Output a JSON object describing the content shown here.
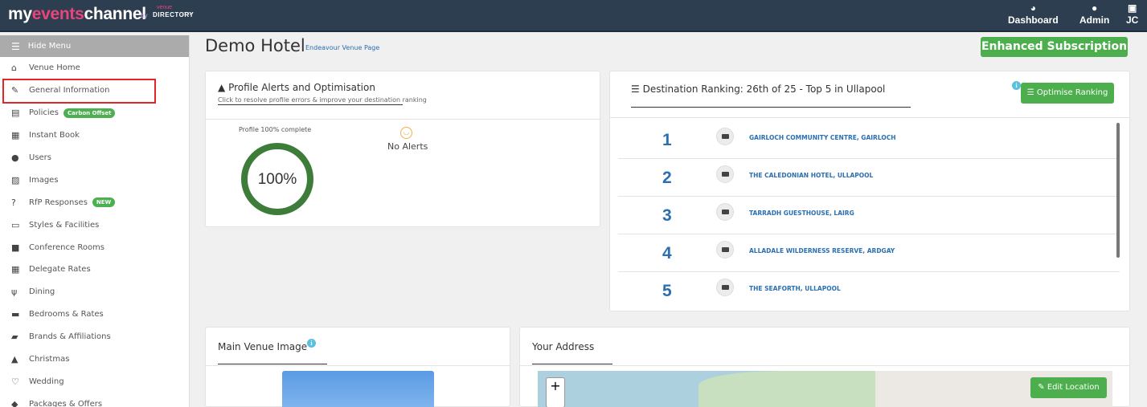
{
  "app": {
    "logo_my": "my",
    "logo_events": "events",
    "logo_channel": "channel",
    "logo_by": "by",
    "logo_venue": "venue",
    "logo_directory": "DIRECTORY",
    "logo_com": ".com"
  },
  "nav": [
    {
      "label": "Dashboard",
      "icon": "dashboard-icon"
    },
    {
      "label": "Admin",
      "icon": "admin-icon"
    },
    {
      "label": "JC",
      "icon": "user-badge-icon"
    }
  ],
  "sidebar": {
    "hide_menu": "Hide Menu",
    "items": [
      {
        "label": "Venue Home",
        "icon": "home-icon"
      },
      {
        "label": "General Information",
        "icon": "edit-icon"
      },
      {
        "label": "Policies",
        "icon": "document-icon",
        "badge": "Carbon Offset"
      },
      {
        "label": "Instant Book",
        "icon": "calendar-icon"
      },
      {
        "label": "Users",
        "icon": "user-icon"
      },
      {
        "label": "Images",
        "icon": "image-icon"
      },
      {
        "label": "RfP Responses",
        "icon": "question-icon",
        "badge": "NEW"
      },
      {
        "label": "Styles & Facilities",
        "icon": "monitor-icon"
      },
      {
        "label": "Conference Rooms",
        "icon": "briefcase-icon"
      },
      {
        "label": "Delegate Rates",
        "icon": "calculator-icon"
      },
      {
        "label": "Dining",
        "icon": "cutlery-icon"
      },
      {
        "label": "Bedrooms & Rates",
        "icon": "bed-icon"
      },
      {
        "label": "Brands & Affiliations",
        "icon": "book-icon"
      },
      {
        "label": "Christmas",
        "icon": "tree-icon"
      },
      {
        "label": "Wedding",
        "icon": "heart-icon"
      },
      {
        "label": "Packages & Offers",
        "icon": "tag-icon"
      }
    ]
  },
  "header": {
    "title": "Demo Hotel",
    "venue_link": "Endeavour Venue Page",
    "subscription": "Enhanced Subscription"
  },
  "alerts": {
    "title": "Profile Alerts and Optimisation",
    "subtitle": "Click to resolve profile errors & improve your destination ranking",
    "profile_label": "Profile 100% complete",
    "percent": "100%",
    "completion": 1.0,
    "no_alerts": "No Alerts"
  },
  "ranking": {
    "title": "Destination Ranking: 26th of 25 - Top 5 in Ullapool",
    "optimise_button": "Optimise Ranking",
    "rows": [
      {
        "rank": "1",
        "name": "GAIRLOCH COMMUNITY CENTRE, GAIRLOCH"
      },
      {
        "rank": "2",
        "name": "THE CALEDONIAN HOTEL, ULLAPOOL"
      },
      {
        "rank": "3",
        "name": "TARRADH GUESTHOUSE, LAIRG"
      },
      {
        "rank": "4",
        "name": "ALLADALE WILDERNESS RESERVE, ARDGAY"
      },
      {
        "rank": "5",
        "name": "THE SEAFORTH, ULLAPOOL"
      }
    ]
  },
  "main_image": {
    "title": "Main Venue Image"
  },
  "address": {
    "title": "Your Address",
    "zoom_in": "+",
    "edit_location": "Edit Location"
  },
  "colors": {
    "topbar": "#2d3e50",
    "accent_pink": "#e9447b",
    "success": "#4cae4c",
    "link": "#2a6fb0",
    "highlight": "#e0262b"
  }
}
